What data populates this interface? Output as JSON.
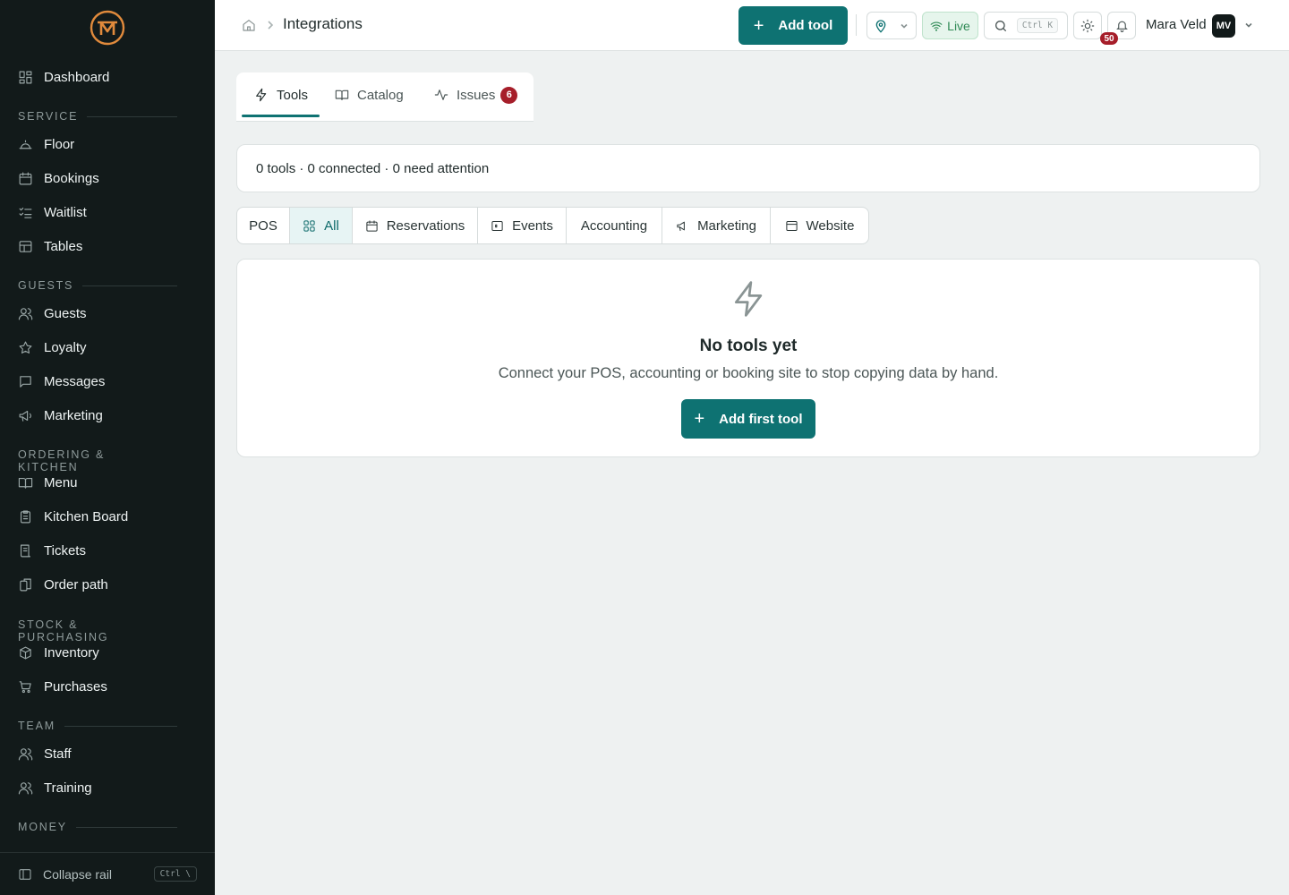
{
  "sidebar": {
    "items": {
      "dashboard": "Dashboard",
      "floor": "Floor",
      "bookings": "Bookings",
      "waitlist": "Waitlist",
      "tables": "Tables",
      "guests": "Guests",
      "loyalty": "Loyalty",
      "messages": "Messages",
      "marketing": "Marketing",
      "menu": "Menu",
      "kitchen_board": "Kitchen Board",
      "tickets": "Tickets",
      "order_path": "Order path",
      "inventory": "Inventory",
      "purchases": "Purchases",
      "staff": "Staff",
      "training": "Training"
    },
    "sections": {
      "service": "SERVICE",
      "guests": "GUESTS",
      "ordering": "ORDERING & KITCHEN",
      "stock": "STOCK & PURCHASING",
      "team": "TEAM",
      "money": "MONEY"
    },
    "footer": {
      "label": "Collapse rail",
      "shortcut": "Ctrl \\"
    }
  },
  "header": {
    "breadcrumb": "Integrations",
    "add_tool": "Add tool",
    "live": "Live",
    "search_shortcut": "Ctrl K",
    "notifications_count": "50",
    "user_name": "Mara Veld",
    "user_initials": "MV"
  },
  "tabs": {
    "tools": "Tools",
    "catalog": "Catalog",
    "issues": "Issues",
    "issues_count": "6"
  },
  "summary": "0 tools · 0 connected · 0 need attention",
  "filters": {
    "pos": "POS",
    "all": "All",
    "reservations": "Reservations",
    "events": "Events",
    "accounting": "Accounting",
    "marketing": "Marketing",
    "website": "Website"
  },
  "empty_state": {
    "title": "No tools yet",
    "text": "Connect your POS, accounting or booking site to stop copying data by hand.",
    "button": "Add first tool"
  },
  "colors": {
    "accent": "#0e7272",
    "sidebar_bg": "#121a1a",
    "live_green": "#2f8a55",
    "badge_red": "#a61e2a"
  }
}
